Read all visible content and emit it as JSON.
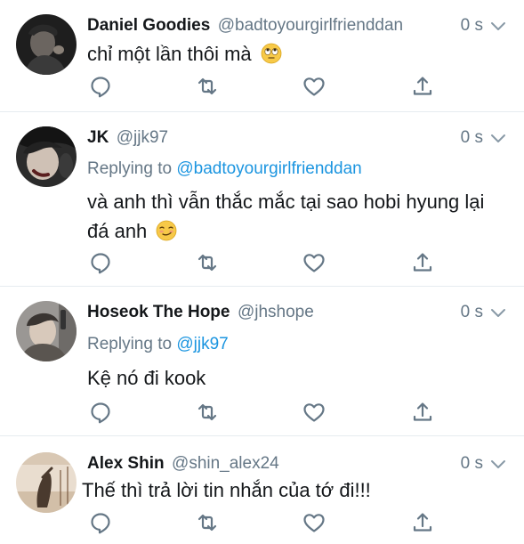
{
  "colors": {
    "link": "#1b95e0",
    "muted": "#657786",
    "divider": "#e6ecf0",
    "icon": "#657786"
  },
  "tweets": [
    {
      "display_name": "Daniel Goodies",
      "handle": "@badtoyourgirlfrienddan",
      "time": "0 s",
      "replying_label": "",
      "replying_to": "",
      "text": "chỉ một lần thôi mà",
      "emoji": "rolling-eyes-emoji"
    },
    {
      "display_name": "JK",
      "handle": "@jjk97",
      "time": "0 s",
      "replying_label": "Replying to",
      "replying_to": "@badtoyourgirlfrienddan",
      "text": "và anh thì vẫn thắc mắc tại sao hobi hyung lại đá anh",
      "emoji": "smirking-face-emoji"
    },
    {
      "display_name": "Hoseok The Hope",
      "handle": "@jhshope",
      "time": "0 s",
      "replying_label": "Replying to",
      "replying_to": "@jjk97",
      "text": "Kệ nó đi kook",
      "emoji": ""
    },
    {
      "display_name": "Alex Shin",
      "handle": "@shin_alex24",
      "time": "0 s",
      "replying_label": "",
      "replying_to": "",
      "text": "Thế thì trả lời tin nhắn của tớ đi!!!",
      "emoji": ""
    }
  ],
  "action_icons": [
    "reply-icon",
    "retweet-icon",
    "like-icon",
    "share-icon"
  ]
}
